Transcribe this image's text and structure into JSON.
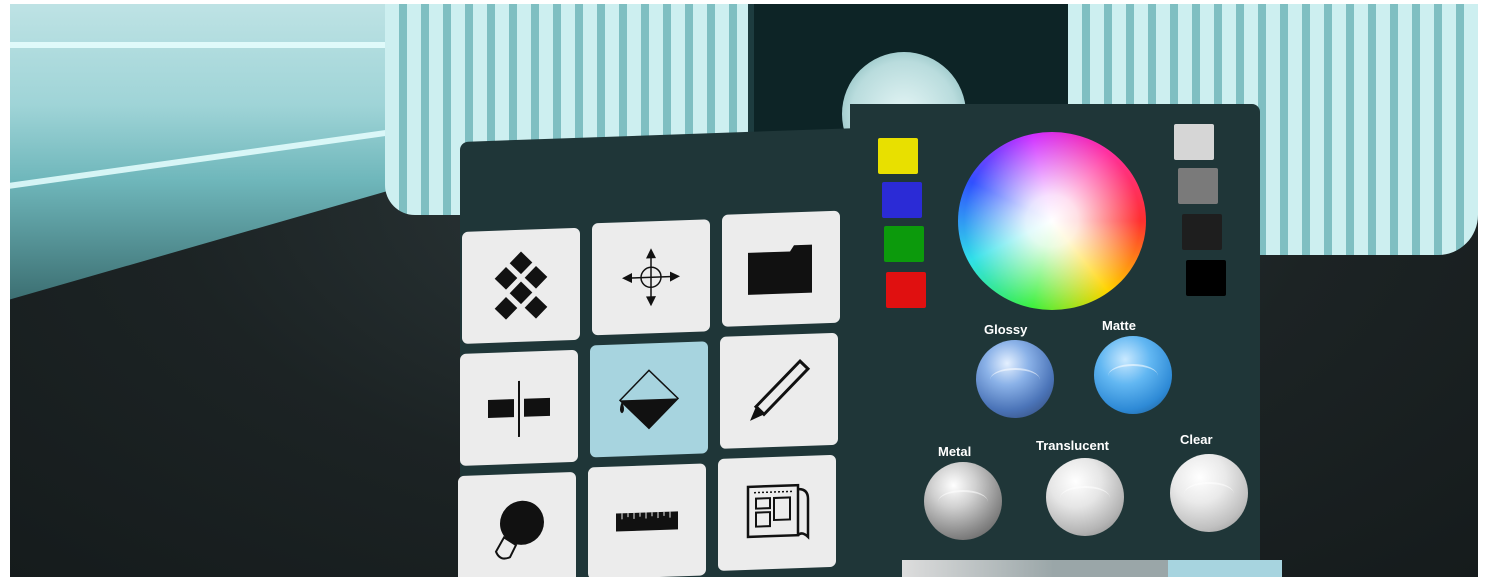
{
  "scene": {
    "description_free": true
  },
  "tool_palette": {
    "tools": [
      {
        "icon": "tiles-icon",
        "selected": false
      },
      {
        "icon": "move-arrows-icon",
        "selected": false
      },
      {
        "icon": "folder-icon",
        "selected": false
      },
      {
        "icon": "mirror-icon",
        "selected": false
      },
      {
        "icon": "fill-bucket-icon",
        "selected": true
      },
      {
        "icon": "pencil-icon",
        "selected": false
      },
      {
        "icon": "lightbulb-icon",
        "selected": false
      },
      {
        "icon": "ruler-icon",
        "selected": false
      },
      {
        "icon": "blueprint-icon",
        "selected": false
      }
    ]
  },
  "color_panel": {
    "color_swatches": [
      "#e8e000",
      "#2b2bd6",
      "#0c9a0c",
      "#e01010"
    ],
    "gray_swatches": [
      "#d6d6d6",
      "#7a7a7a",
      "#1e1e1e",
      "#000000"
    ],
    "materials": [
      {
        "label": "Glossy",
        "type": "glossy"
      },
      {
        "label": "Matte",
        "type": "matte"
      },
      {
        "label": "Metal",
        "type": "metal"
      },
      {
        "label": "Translucent",
        "type": "translucent"
      },
      {
        "label": "Clear",
        "type": "clear"
      }
    ],
    "accent_selected": "#a7d4df"
  }
}
